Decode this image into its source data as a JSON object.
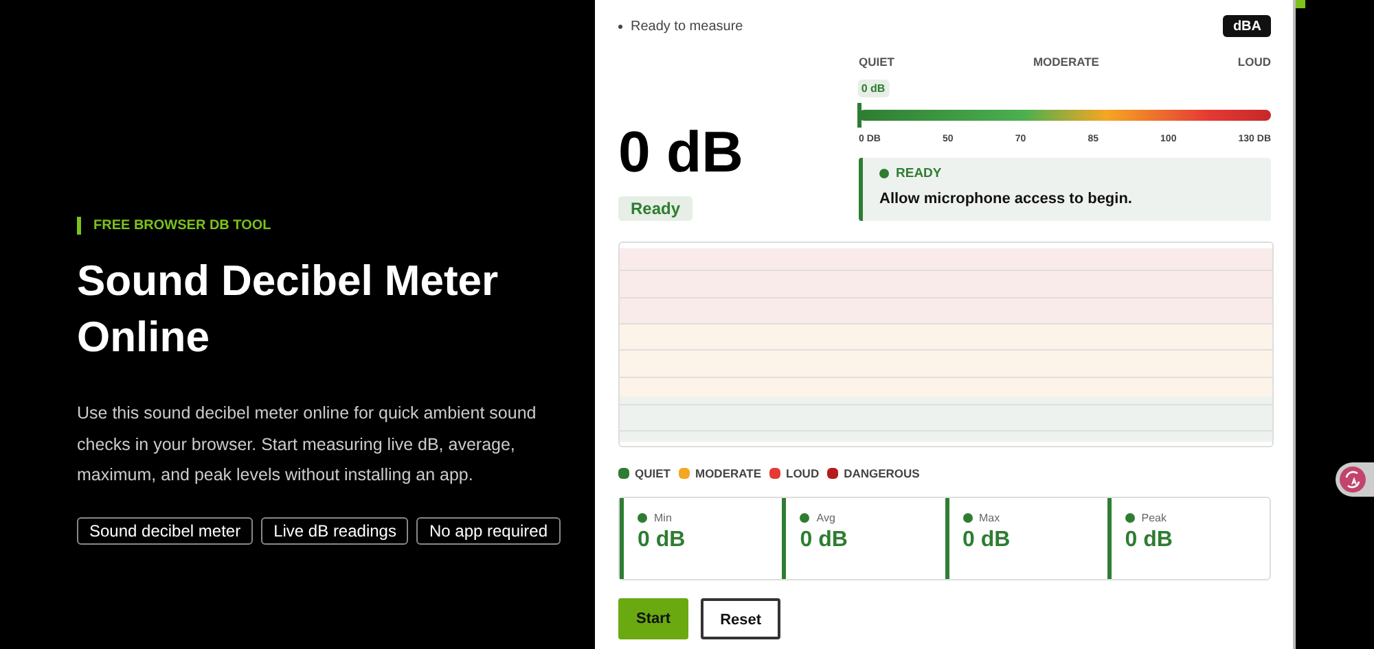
{
  "hero": {
    "eyebrow": "FREE BROWSER DB TOOL",
    "title": "Sound Decibel Meter Online",
    "description": "Use this sound decibel meter online for quick ambient sound checks in your browser. Start measuring live dB, average, maximum, and peak levels without installing an app.",
    "chips": [
      "Sound decibel meter",
      "Live dB readings",
      "No app required"
    ]
  },
  "meter": {
    "status_text": "Ready to measure",
    "weighting_button": "dBA",
    "reading": "0 dB",
    "badge": "Ready",
    "scale_labels": [
      "QUIET",
      "MODERATE",
      "LOUD"
    ],
    "marker_label": "0 dB",
    "level": 0,
    "ticks": [
      "0 DB",
      "50",
      "70",
      "85",
      "100",
      "130 DB"
    ],
    "notice": {
      "title": "READY",
      "message": "Allow microphone access to begin."
    },
    "legend": [
      {
        "label": "QUIET",
        "color": "#2e7d32"
      },
      {
        "label": "MODERATE",
        "color": "#f5a623"
      },
      {
        "label": "LOUD",
        "color": "#e53935"
      },
      {
        "label": "DANGEROUS",
        "color": "#b71c1c"
      }
    ],
    "stats": [
      {
        "label": "Min",
        "value": "0 dB"
      },
      {
        "label": "Avg",
        "value": "0 dB"
      },
      {
        "label": "Max",
        "value": "0 dB"
      },
      {
        "label": "Peak",
        "value": "0 dB"
      }
    ],
    "buttons": [
      {
        "label": "Start",
        "kind": "primary"
      },
      {
        "label": "Reset",
        "kind": "secondary"
      }
    ]
  }
}
